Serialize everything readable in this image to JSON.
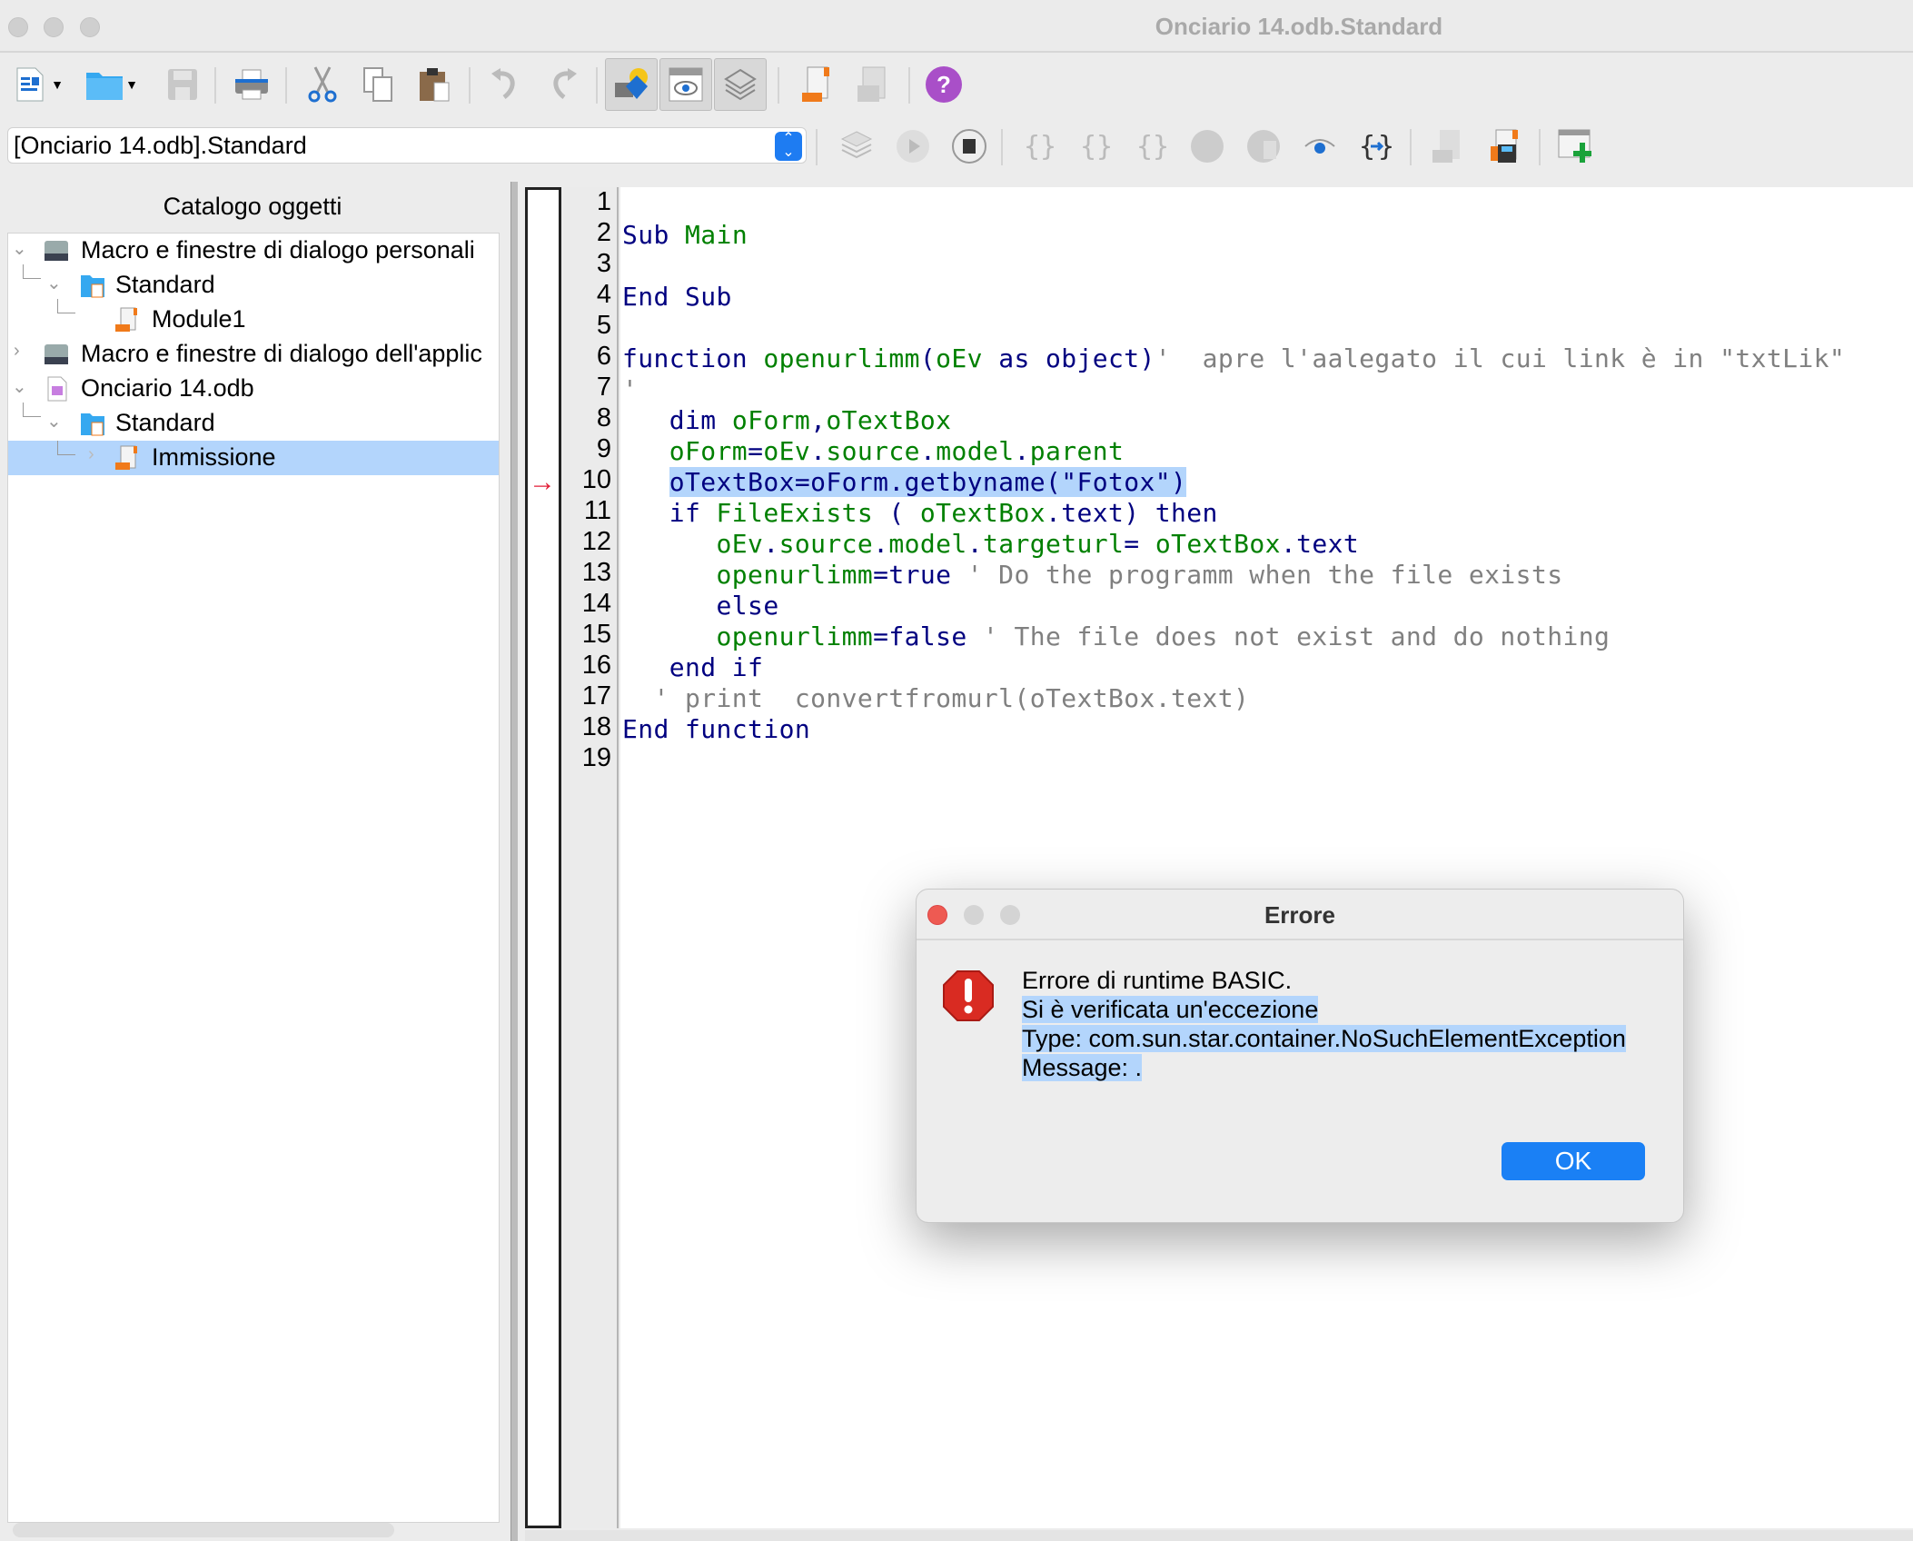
{
  "window": {
    "title": "Onciario 14.odb.Standard"
  },
  "toolbar": {
    "items": [
      {
        "name": "new-document",
        "icon": "new-document-icon"
      },
      {
        "name": "open",
        "icon": "folder-icon"
      },
      {
        "name": "save",
        "icon": "save-icon"
      },
      {
        "name": "print",
        "icon": "printer-icon"
      },
      {
        "name": "cut",
        "icon": "scissors-icon"
      },
      {
        "name": "copy",
        "icon": "copy-icon"
      },
      {
        "name": "paste",
        "icon": "paste-icon"
      },
      {
        "name": "undo",
        "icon": "undo-icon"
      },
      {
        "name": "redo",
        "icon": "redo-icon"
      },
      {
        "name": "object-catalog",
        "icon": "shapes-icon"
      },
      {
        "name": "watch-window",
        "icon": "eye-window-icon"
      },
      {
        "name": "stack-window",
        "icon": "layers-icon"
      },
      {
        "name": "select-module",
        "icon": "module-icon"
      },
      {
        "name": "manage-dialogs",
        "icon": "dialog-icon"
      },
      {
        "name": "help",
        "icon": "help-icon"
      }
    ]
  },
  "library_selector": {
    "value": "[Onciario 14.odb].Standard"
  },
  "toolbar2": {
    "items": [
      {
        "name": "compile",
        "icon": "compile-icon"
      },
      {
        "name": "run",
        "icon": "play-icon"
      },
      {
        "name": "stop",
        "icon": "stop-icon"
      },
      {
        "name": "step-into",
        "icon": "step-into-icon"
      },
      {
        "name": "step-over",
        "icon": "step-over-icon"
      },
      {
        "name": "step-out",
        "icon": "step-out-icon"
      },
      {
        "name": "breakpoint",
        "icon": "breakpoint-icon"
      },
      {
        "name": "manage-breakpoints",
        "icon": "breakpoint-manage-icon"
      },
      {
        "name": "enable-watch",
        "icon": "eye-icon"
      },
      {
        "name": "find-parentheses",
        "icon": "braces-icon"
      },
      {
        "name": "import-basic",
        "icon": "import-icon"
      },
      {
        "name": "export-basic",
        "icon": "export-icon"
      },
      {
        "name": "insert-controls",
        "icon": "add-control-icon"
      }
    ]
  },
  "sidebar": {
    "title": "Catalogo oggetti",
    "tree": [
      {
        "label": "Macro e finestre di dialogo personali",
        "level": 0,
        "expanded": true,
        "icon": "drive-icon"
      },
      {
        "label": "Standard",
        "level": 1,
        "expanded": true,
        "icon": "library-folder-icon"
      },
      {
        "label": "Module1",
        "level": 2,
        "icon": "module-icon"
      },
      {
        "label": "Macro e finestre di dialogo dell'applic",
        "level": 0,
        "expanded": false,
        "icon": "drive-icon"
      },
      {
        "label": "Onciario 14.odb",
        "level": 0,
        "expanded": true,
        "icon": "database-file-icon"
      },
      {
        "label": "Standard",
        "level": 1,
        "expanded": true,
        "icon": "library-folder-icon"
      },
      {
        "label": "Immissione",
        "level": 2,
        "selected": true,
        "icon": "module-icon"
      }
    ]
  },
  "editor": {
    "current_line": 10,
    "lines": [
      {
        "n": "1",
        "tokens": []
      },
      {
        "n": "2",
        "tokens": [
          {
            "t": "Sub",
            "c": "kw"
          },
          {
            "t": " "
          },
          {
            "t": "Main",
            "c": "id"
          }
        ]
      },
      {
        "n": "3",
        "tokens": []
      },
      {
        "n": "4",
        "tokens": [
          {
            "t": "End Sub",
            "c": "kw"
          }
        ]
      },
      {
        "n": "5",
        "tokens": []
      },
      {
        "n": "6",
        "tokens": [
          {
            "t": "function",
            "c": "kw"
          },
          {
            "t": " "
          },
          {
            "t": "openurlimm",
            "c": "id"
          },
          {
            "t": "(",
            "c": "kw"
          },
          {
            "t": "oEv",
            "c": "id"
          },
          {
            "t": " as object)",
            "c": "kw"
          },
          {
            "t": "'  apre l'aalegato il cui link è in \"txtLik\"",
            "c": "cm"
          }
        ]
      },
      {
        "n": "7",
        "tokens": [
          {
            "t": "'",
            "c": "cm"
          }
        ]
      },
      {
        "n": "8",
        "tokens": [
          {
            "t": "   dim ",
            "c": "kw"
          },
          {
            "t": "oForm",
            "c": "id"
          },
          {
            "t": ",",
            "c": "kw"
          },
          {
            "t": "oTextBox",
            "c": "id"
          }
        ]
      },
      {
        "n": "9",
        "tokens": [
          {
            "t": "   "
          },
          {
            "t": "oForm",
            "c": "id"
          },
          {
            "t": "=",
            "c": "kw"
          },
          {
            "t": "oEv",
            "c": "id"
          },
          {
            "t": ".",
            "c": "kw"
          },
          {
            "t": "source",
            "c": "id"
          },
          {
            "t": ".",
            "c": "kw"
          },
          {
            "t": "model",
            "c": "id"
          },
          {
            "t": ".",
            "c": "kw"
          },
          {
            "t": "parent",
            "c": "id"
          }
        ]
      },
      {
        "n": "10",
        "tokens": [
          {
            "t": "   "
          },
          {
            "t": "oTextBox=oForm.getbyname(\"Fotox\")",
            "c": "kw",
            "hl": true
          }
        ]
      },
      {
        "n": "11",
        "tokens": [
          {
            "t": "   if ",
            "c": "kw"
          },
          {
            "t": "FileExists",
            "c": "id"
          },
          {
            "t": " ( ",
            "c": "kw"
          },
          {
            "t": "oTextBox",
            "c": "id"
          },
          {
            "t": ".text) then",
            "c": "kw"
          }
        ]
      },
      {
        "n": "12",
        "tokens": [
          {
            "t": "      "
          },
          {
            "t": "oEv",
            "c": "id"
          },
          {
            "t": ".",
            "c": "kw"
          },
          {
            "t": "source",
            "c": "id"
          },
          {
            "t": ".",
            "c": "kw"
          },
          {
            "t": "model",
            "c": "id"
          },
          {
            "t": ".",
            "c": "kw"
          },
          {
            "t": "targeturl",
            "c": "id"
          },
          {
            "t": "= ",
            "c": "kw"
          },
          {
            "t": "oTextBox",
            "c": "id"
          },
          {
            "t": ".text",
            "c": "kw"
          }
        ]
      },
      {
        "n": "13",
        "tokens": [
          {
            "t": "      "
          },
          {
            "t": "openurlimm",
            "c": "id"
          },
          {
            "t": "=true ",
            "c": "kw"
          },
          {
            "t": "' Do the programm when the file exists",
            "c": "cm"
          }
        ]
      },
      {
        "n": "14",
        "tokens": [
          {
            "t": "      else",
            "c": "kw"
          }
        ]
      },
      {
        "n": "15",
        "tokens": [
          {
            "t": "      "
          },
          {
            "t": "openurlimm",
            "c": "id"
          },
          {
            "t": "=false ",
            "c": "kw"
          },
          {
            "t": "' The file does not exist and do nothing",
            "c": "cm"
          }
        ]
      },
      {
        "n": "16",
        "tokens": [
          {
            "t": "   end if",
            "c": "kw"
          }
        ]
      },
      {
        "n": "17",
        "tokens": [
          {
            "t": "  ' print  convertfromurl(oTextBox.text)",
            "c": "cm"
          }
        ]
      },
      {
        "n": "18",
        "tokens": [
          {
            "t": "End function",
            "c": "kw"
          }
        ]
      },
      {
        "n": "19",
        "tokens": []
      }
    ]
  },
  "dialog": {
    "title": "Errore",
    "icon": "error-stop-icon",
    "lines": [
      "Errore di runtime BASIC.",
      "Si è verificata un'eccezione",
      "Type: com.sun.star.container.NoSuchElementException",
      "Message: ."
    ],
    "ok_label": "OK"
  },
  "colors": {
    "keyword": "#000080",
    "identifier": "#008000",
    "comment": "#808080",
    "selection": "#b3d5fc",
    "accent": "#1a80f5",
    "exec_arrow": "#e21d36"
  }
}
